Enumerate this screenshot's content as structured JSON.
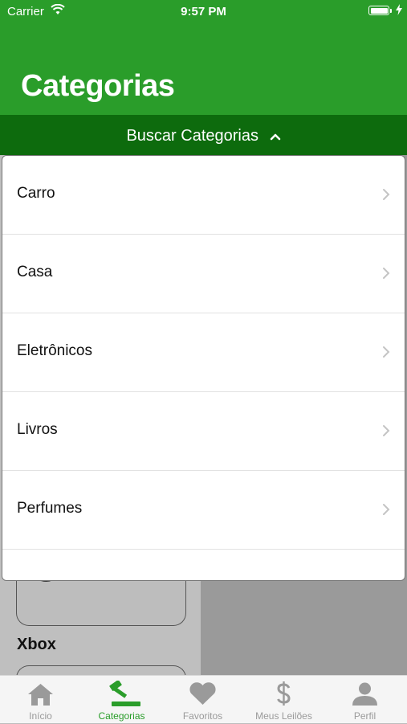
{
  "status_bar": {
    "carrier": "Carrier",
    "time": "9:57 PM"
  },
  "header": {
    "title": "Categorias"
  },
  "search": {
    "label": "Buscar Categorias"
  },
  "categories": [
    {
      "label": "Carro"
    },
    {
      "label": "Casa"
    },
    {
      "label": "Eletrônicos"
    },
    {
      "label": "Livros"
    },
    {
      "label": "Perfumes"
    },
    {
      "label": ""
    }
  ],
  "background_item": {
    "label": "Xbox"
  },
  "tabs": [
    {
      "label": "Início",
      "icon": "home-icon"
    },
    {
      "label": "Categorias",
      "icon": "gavel-icon",
      "active": true
    },
    {
      "label": "Favoritos",
      "icon": "heart-icon"
    },
    {
      "label": "Meus Leilões",
      "icon": "dollar-icon"
    },
    {
      "label": "Perfil",
      "icon": "person-icon"
    }
  ],
  "colors": {
    "primary": "#2a9d2a",
    "primary_dark": "#0d6b0d",
    "tab_inactive": "#9a9a9a"
  }
}
